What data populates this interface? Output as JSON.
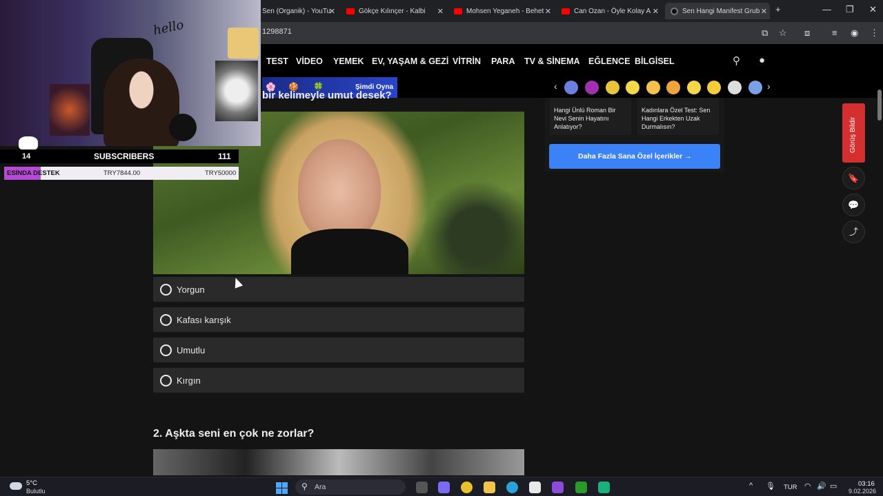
{
  "browser": {
    "tabs": [
      {
        "label": "Sen (Organik) - YouTu",
        "active": false
      },
      {
        "label": "Gökçe Kılınçer - Kalbi",
        "active": false
      },
      {
        "label": "Mohsen Yeganeh - Behet",
        "active": false
      },
      {
        "label": "Can Ozan - Öyle Kolay A",
        "active": false
      },
      {
        "label": "Sen Hangi Manifest Grub",
        "active": true
      }
    ],
    "url": "1298871",
    "new_tab": "+"
  },
  "site_nav": {
    "items": [
      "TEST",
      "VİDEO",
      "YEMEK",
      "EV, YAŞAM & GEZİ",
      "VİTRİN",
      "PARA",
      "TV & SİNEMA",
      "EĞLENCE",
      "BİLGİSEL"
    ]
  },
  "promo": {
    "play_label": "Şimdi Oyna"
  },
  "question1": {
    "title_fragment": "bir kelimeyle umut desek?",
    "options": [
      "Yorgun",
      "Kafası karışık",
      "Umutlu",
      "Kırgın"
    ]
  },
  "question2": {
    "title": "2. Aşkta seni en çok ne zorlar?"
  },
  "sidebar": {
    "cards": [
      "Hangi Ünlü Roman Bir Nevi Senin Hayatını Anlatıyor?",
      "Kadınlara Özel Test: Sen Hangi Erkekten Uzak Durmalısın?"
    ],
    "more_button": "Daha Fazla Sana Özel İçerikler →",
    "feedback": "Görüş Bildir"
  },
  "stream_overlay": {
    "cam_text": "hello",
    "level": "14",
    "subscribers_label": "SUBSCRIBERS",
    "subscribers_count": "111",
    "donation_label": "ESİNDA DESTEK",
    "donation_current": "TRY7844.00",
    "donation_goal": "TRY50000",
    "donation_progress": 0.157
  },
  "taskbar": {
    "weather_temp": "5°C",
    "weather_desc": "Bulutlu",
    "search_placeholder": "Ara",
    "lang": "TUR",
    "time": "03:16",
    "date": "9.02.2026"
  },
  "colors": {
    "nav_bg": "#000000",
    "option_bg": "#2a2a2a",
    "more_button": "#3b82f6",
    "feedback": "#d32f2f",
    "donation_fill": "#b84ad8"
  }
}
